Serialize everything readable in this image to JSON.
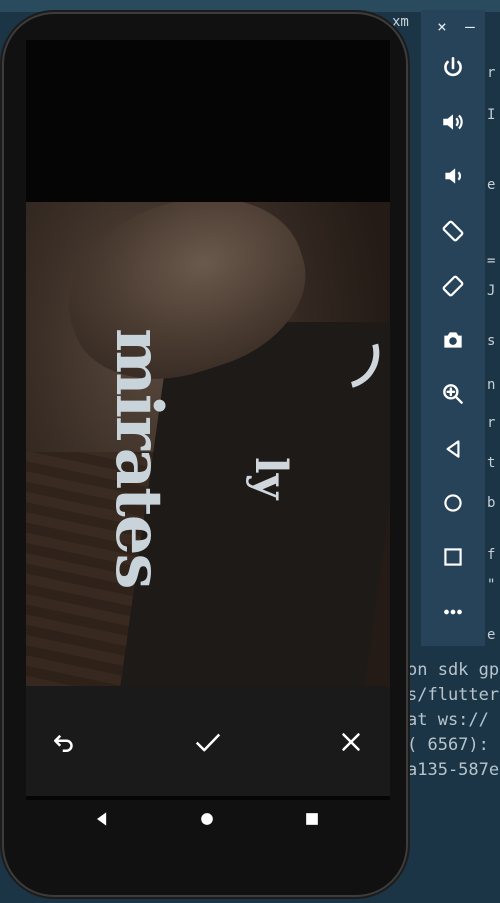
{
  "ide": {
    "tab_label": "xm",
    "right_column": [
      "r",
      "I",
      "e",
      "=",
      "J",
      "s",
      "n",
      "r",
      "t",
      "b",
      "f",
      "\"",
      "e"
    ],
    "terminal_lines": [
      "on sdk gp",
      "s/flutter",
      " at ws://",
      "( 6567):",
      "a135-587e"
    ]
  },
  "emulator": {
    "close_label": "×",
    "minimize_label": "–",
    "controls": [
      {
        "name": "power",
        "icon": "power-icon"
      },
      {
        "name": "volume-up",
        "icon": "volume-up-icon"
      },
      {
        "name": "volume-down",
        "icon": "volume-down-icon"
      },
      {
        "name": "rotate-left",
        "icon": "rotate-left-icon"
      },
      {
        "name": "rotate-right",
        "icon": "rotate-right-icon"
      },
      {
        "name": "screenshot",
        "icon": "camera-icon"
      },
      {
        "name": "zoom",
        "icon": "zoom-icon"
      },
      {
        "name": "back",
        "icon": "back-triangle-icon"
      },
      {
        "name": "home",
        "icon": "home-circle-icon"
      },
      {
        "name": "overview",
        "icon": "overview-square-icon"
      },
      {
        "name": "more",
        "icon": "more-dots-icon"
      }
    ]
  },
  "phone": {
    "photo_text": "mirates",
    "photo_text2": "ly",
    "actions": [
      {
        "name": "retake",
        "icon": "undo-arrow-icon"
      },
      {
        "name": "confirm",
        "icon": "check-icon"
      },
      {
        "name": "cancel",
        "icon": "close-icon"
      }
    ],
    "colors": {
      "action_bar": "#1a1a1a",
      "icons": "#ffffff"
    }
  }
}
